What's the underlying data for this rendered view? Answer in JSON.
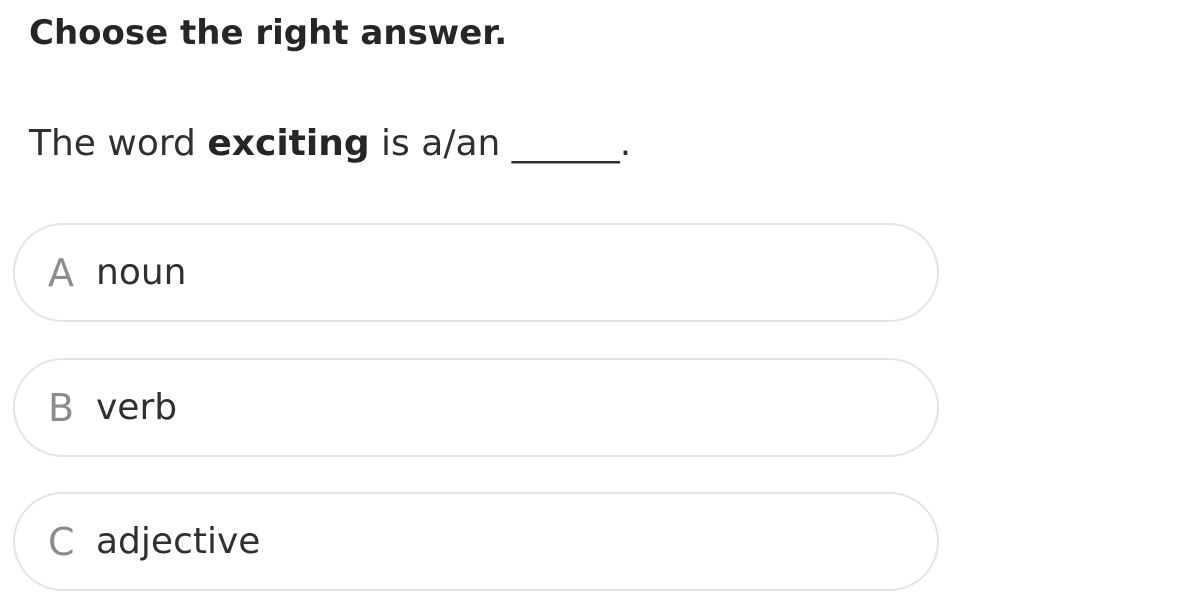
{
  "instruction": "Choose the right answer.",
  "question": {
    "prefix": "The word ",
    "keyword": "exciting",
    "suffix": " is a/an ______."
  },
  "options": [
    {
      "letter": "A",
      "text": "noun"
    },
    {
      "letter": "B",
      "text": "verb"
    },
    {
      "letter": "C",
      "text": "adjective"
    }
  ]
}
